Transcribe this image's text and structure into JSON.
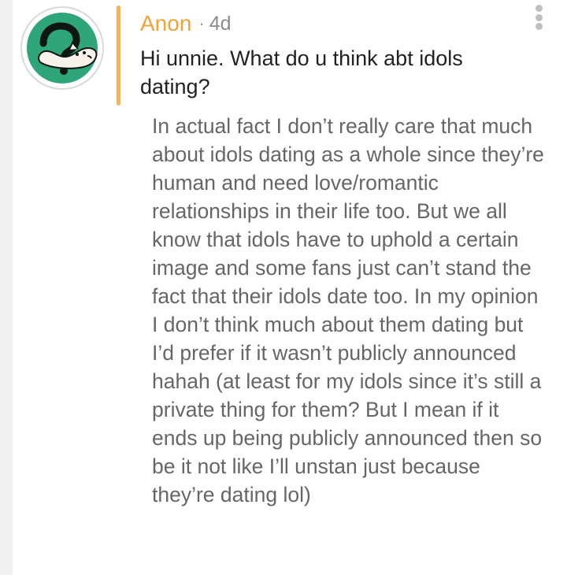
{
  "post": {
    "author": "Anon",
    "separator": "·",
    "time": "4d",
    "question": "Hi unnie. What do u think abt idols dating?",
    "answer": "In actual fact I don’t really care that much about idols dating as a whole since they’re human and need love/romantic relationships in their life too. But we all know that idols have to uphold a certain image and some fans just can’t stand the fact that their idols date too. In my opinion I don’t think much about them dating but I’d prefer if it wasn’t publicly announced hahah (at least for my idols since it’s still a private thing for them? But I mean if it ends up being publicly announced then so be it not like I’ll unstan just because they’re dating lol)",
    "avatar_icon": "anon-question-cat-icon",
    "menu_icon": "more-vertical-icon"
  },
  "colors": {
    "author": "#f0a336",
    "accent_bar": "#f0b469",
    "avatar_bg": "#2ea67a",
    "question_text": "#222222",
    "answer_text": "#666666"
  }
}
